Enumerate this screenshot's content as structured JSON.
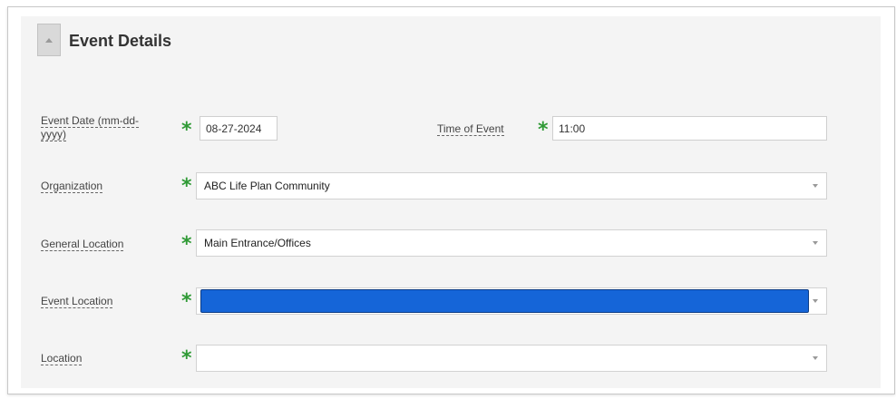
{
  "section": {
    "title": "Event Details",
    "collapse_icon": "chevron-up-icon"
  },
  "fields": {
    "event_date": {
      "label": "Event Date (mm-dd-yyyy)",
      "value": "08-27-2024",
      "required": true
    },
    "time_of_event": {
      "label": "Time of Event",
      "value": "11:00",
      "required": true
    },
    "organization": {
      "label": "Organization",
      "value": "ABC Life Plan Community",
      "required": true
    },
    "general_location": {
      "label": "General Location",
      "value": "Main Entrance/Offices",
      "required": true
    },
    "event_location": {
      "label": "Event Location",
      "value": "",
      "required": true,
      "focused": true
    },
    "location": {
      "label": "Location",
      "value": "",
      "required": true
    }
  },
  "required_marker": "*",
  "colors": {
    "required": "#2f9a35",
    "focus_fill": "#1565d8"
  }
}
